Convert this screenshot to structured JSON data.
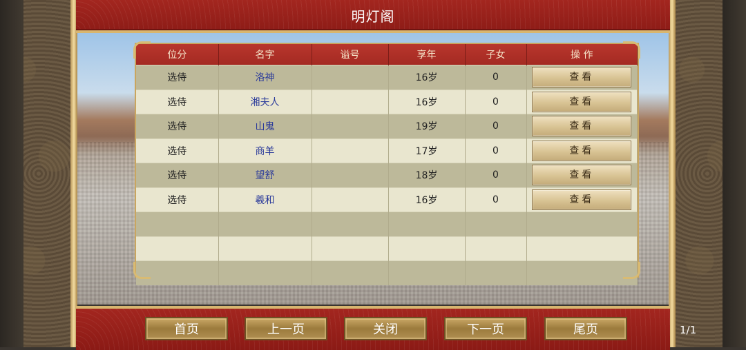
{
  "window_title": "明灯阁",
  "table": {
    "headers": [
      "位分",
      "名字",
      "谥号",
      "享年",
      "子女",
      "操 作"
    ],
    "rows": [
      {
        "rank": "选侍",
        "name": "洛神",
        "posthumous": "",
        "age": "16岁",
        "children": "0",
        "action": "查看"
      },
      {
        "rank": "选侍",
        "name": "湘夫人",
        "posthumous": "",
        "age": "16岁",
        "children": "0",
        "action": "查看"
      },
      {
        "rank": "选侍",
        "name": "山鬼",
        "posthumous": "",
        "age": "19岁",
        "children": "0",
        "action": "查看"
      },
      {
        "rank": "选侍",
        "name": "商羊",
        "posthumous": "",
        "age": "17岁",
        "children": "0",
        "action": "查看"
      },
      {
        "rank": "选侍",
        "name": "望舒",
        "posthumous": "",
        "age": "18岁",
        "children": "0",
        "action": "查看"
      },
      {
        "rank": "选侍",
        "name": "羲和",
        "posthumous": "",
        "age": "16岁",
        "children": "0",
        "action": "查看"
      }
    ],
    "empty_rows": 3
  },
  "footer": {
    "first_page": "首页",
    "prev_page": "上一页",
    "close": "关闭",
    "next_page": "下一页",
    "last_page": "尾页",
    "page_indicator": "1/1"
  },
  "colors": {
    "banner_red": "#a3261f",
    "gold": "#d8b670",
    "name_blue": "#2a3a9a"
  }
}
